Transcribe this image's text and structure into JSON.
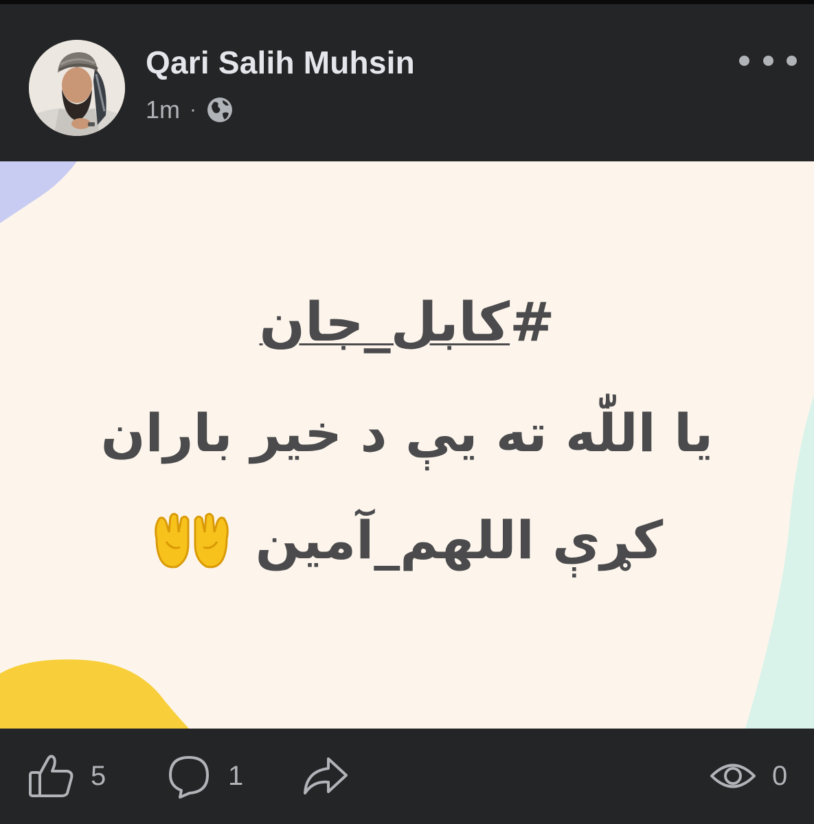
{
  "post": {
    "author": "Qari Salih Muhsin",
    "timestamp": "1m",
    "meta_separator": "·",
    "audience_icon": "globe-icon",
    "more_icon": "more-horizontal-icon",
    "background_color": "#fdf5ec",
    "text_color": "#4b4b4d"
  },
  "content": {
    "hashtag_symbol": "#",
    "hashtag_text": "کابل_جان",
    "line1": "یا اللّٰه ته یې د خیر باران",
    "line2": "کړې اللهم_آمین",
    "emoji": "palms-up-together-emoji"
  },
  "actions": {
    "like_icon": "thumbs-up-icon",
    "like_count": "5",
    "comment_icon": "comment-icon",
    "comment_count": "1",
    "share_icon": "share-icon",
    "views_icon": "eye-icon",
    "views_count": "0"
  },
  "colors": {
    "dark_surface": "#242526",
    "primary_text": "#e4e6eb",
    "secondary_text": "#b0b3b8",
    "deco_blue": "#c9ccf2",
    "deco_yellow": "#f8cf3a",
    "deco_mint": "#d9f3ea"
  }
}
